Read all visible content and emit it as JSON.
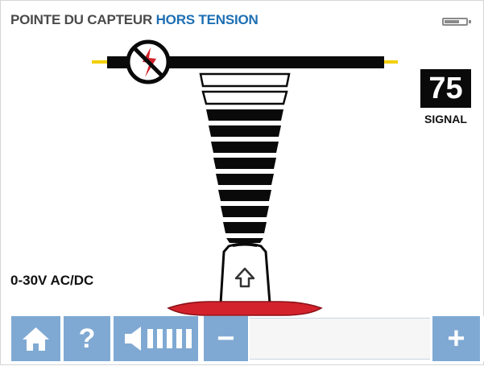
{
  "header": {
    "title_part1": "POINTE DU CAPTEUR",
    "title_part2": "HORS TENSION"
  },
  "battery": {
    "icon": "battery-icon"
  },
  "signal": {
    "value": "75",
    "label": "SIGNAL"
  },
  "range_label": "0-30V AC/DC",
  "probe": {
    "arrow_icon": "arrow-up-icon",
    "warning_icon": "no-voltage-icon"
  },
  "toolbar": {
    "home_icon": "home-icon",
    "help_label": "?",
    "volume_icon": "speaker-volume-icon",
    "minus_label": "−",
    "plus_label": "+"
  },
  "colors": {
    "accent_blue": "#1e6fb3",
    "toolbar_blue": "#7fa9d3",
    "probe_red": "#d3222c",
    "wire_yellow": "#f2cf00",
    "text_dark": "#111111"
  }
}
